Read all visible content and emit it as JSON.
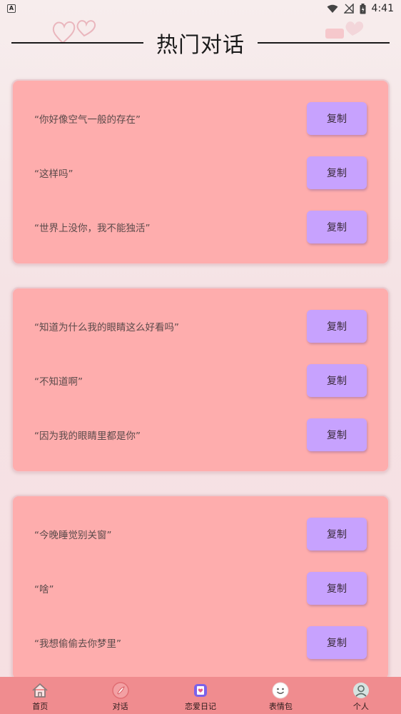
{
  "status_bar": {
    "time": "4:41",
    "notification_icon": "A"
  },
  "header": {
    "title": "热门对话"
  },
  "cards": [
    {
      "lines": [
        {
          "text": "“你好像空气一般的存在”",
          "button": "复制"
        },
        {
          "text": "“这样吗”",
          "button": "复制"
        },
        {
          "text": "“世界上没你，我不能独活”",
          "button": "复制"
        }
      ]
    },
    {
      "lines": [
        {
          "text": "“知道为什么我的眼睛这么好看吗”",
          "button": "复制"
        },
        {
          "text": "“不知道啊”",
          "button": "复制"
        },
        {
          "text": "“因为我的眼睛里都是你”",
          "button": "复制"
        }
      ]
    },
    {
      "lines": [
        {
          "text": "“今晚睡觉别关窗”",
          "button": "复制"
        },
        {
          "text": "“啥”",
          "button": "复制"
        },
        {
          "text": "“我想偷偷去你梦里”",
          "button": "复制"
        }
      ]
    }
  ],
  "tabs": [
    {
      "label": "首页",
      "icon": "home-icon"
    },
    {
      "label": "对话",
      "icon": "chat-icon"
    },
    {
      "label": "恋爱日记",
      "icon": "diary-icon"
    },
    {
      "label": "表情包",
      "icon": "emoji-icon"
    },
    {
      "label": "个人",
      "icon": "profile-icon"
    }
  ],
  "colors": {
    "card_bg": "#feadad",
    "button_bg": "#c7a2fe",
    "tab_bar_bg": "#f08c8f"
  }
}
